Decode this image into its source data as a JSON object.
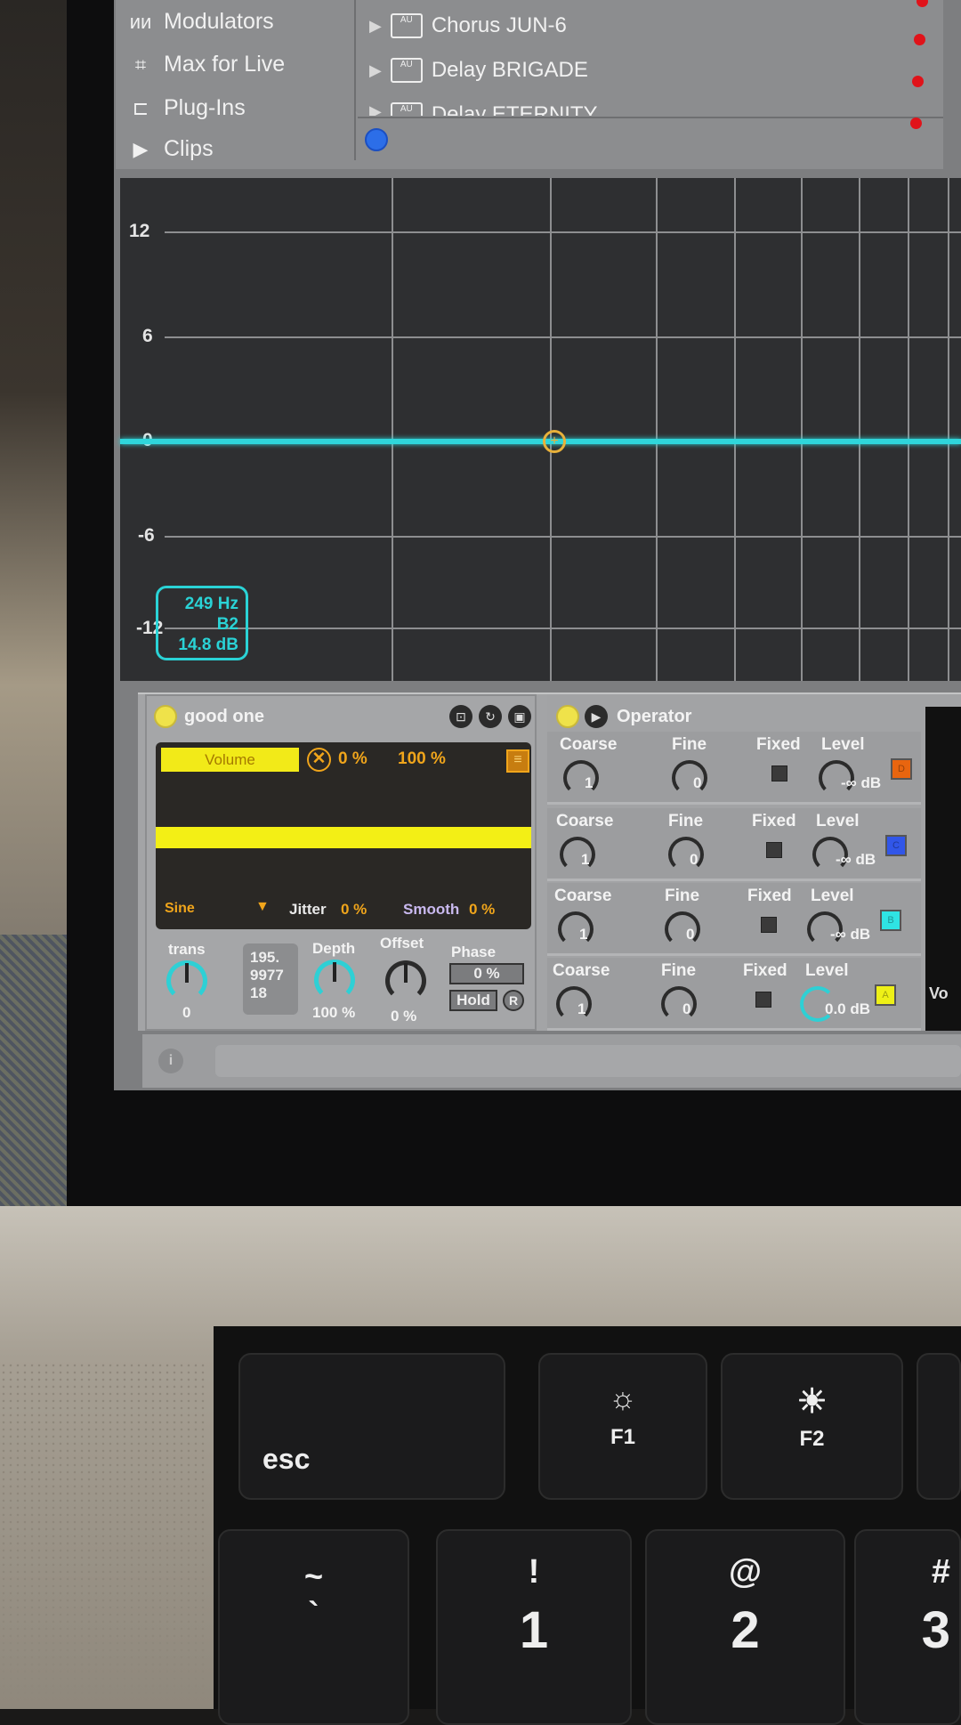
{
  "browser": {
    "sidebar": [
      {
        "label": "Modulators",
        "icon": "modulators-icon"
      },
      {
        "label": "Max for Live",
        "icon": "max-icon"
      },
      {
        "label": "Plug-Ins",
        "icon": "plug-icon"
      },
      {
        "label": "Clips",
        "icon": "clip-icon"
      }
    ],
    "items": [
      {
        "label": "Chorus JUN-6",
        "badge": "AU"
      },
      {
        "label": "Delay BRIGADE",
        "badge": "AU"
      },
      {
        "label": "Delay ETERNITY",
        "badge": "AU"
      }
    ],
    "status_color": "#e0131a"
  },
  "eq": {
    "y_ticks": [
      "12",
      "6",
      "0",
      "-6",
      "-12"
    ],
    "readout": {
      "freq": "249 Hz",
      "note": "B2",
      "gain": "14.8 dB"
    },
    "curve_color": "#2fd6db"
  },
  "lfo": {
    "title": "good one",
    "target": "Volume",
    "min": "0 %",
    "max": "100 %",
    "waveform": "Sine",
    "jitter_label": "Jitter",
    "jitter": "0 %",
    "smooth_label": "Smooth",
    "smooth": "0 %",
    "trans_label": "trans",
    "trans": "0",
    "rate": [
      "195.",
      "9977",
      "18"
    ],
    "depth_label": "Depth",
    "depth": "100 %",
    "offset_label": "Offset",
    "offset": "0 %",
    "phase_label": "Phase",
    "phase": "0 %",
    "hold": "Hold",
    "retrigger": "R"
  },
  "operator": {
    "title": "Operator",
    "rows": [
      {
        "coarse": "1",
        "fine": "0",
        "level": "-∞ dB",
        "osc": "D",
        "color": "#e8650f"
      },
      {
        "coarse": "1",
        "fine": "0",
        "level": "-∞ dB",
        "osc": "C",
        "color": "#3156e8"
      },
      {
        "coarse": "1",
        "fine": "0",
        "level": "-∞ dB",
        "osc": "B",
        "color": "#2fe3e3"
      },
      {
        "coarse": "1",
        "fine": "0",
        "level": "0.0 dB",
        "osc": "A",
        "color": "#eef017"
      }
    ],
    "labels": {
      "coarse": "Coarse",
      "fine": "Fine",
      "fixed": "Fixed",
      "level": "Level"
    },
    "side_label": "Vo"
  },
  "keyboard": {
    "esc": "esc",
    "f1": "F1",
    "f2": "F2",
    "k1": [
      "!",
      "1"
    ],
    "k2": [
      "@",
      "2"
    ],
    "k3": [
      "#",
      "3"
    ],
    "tilde": [
      "~",
      "`"
    ]
  }
}
